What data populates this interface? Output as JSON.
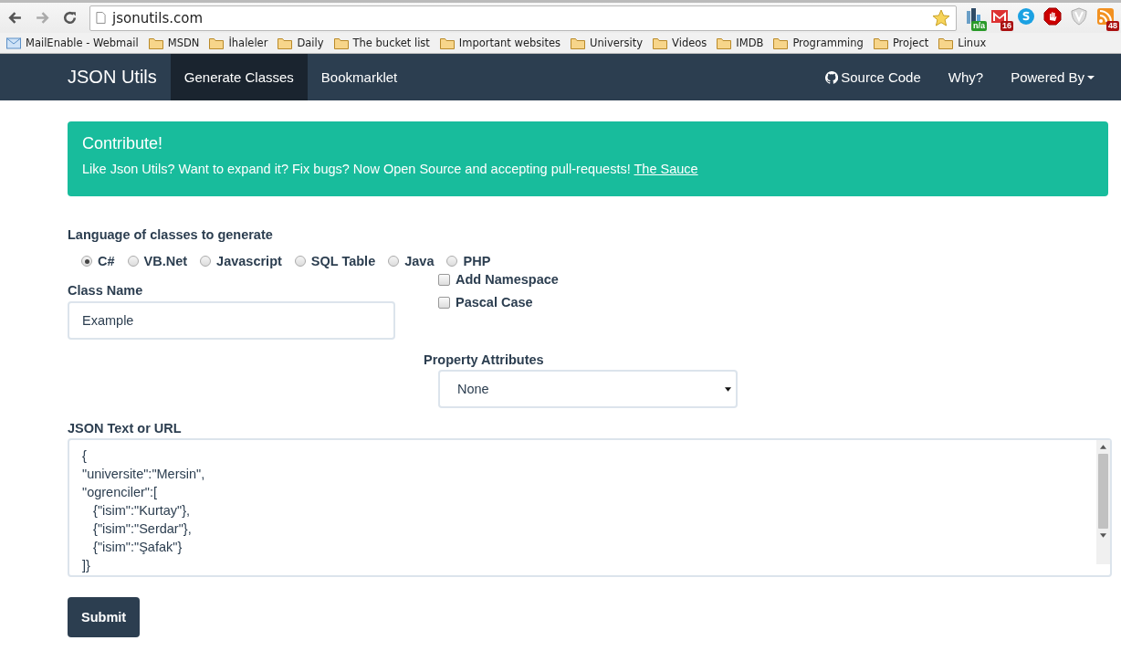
{
  "browser": {
    "url": "jsonutils.com",
    "bookmarks": [
      {
        "label": "MailEnable - Webmail",
        "kind": "mail"
      },
      {
        "label": "MSDN",
        "kind": "folder"
      },
      {
        "label": "İhaleler",
        "kind": "folder"
      },
      {
        "label": "Daily",
        "kind": "folder"
      },
      {
        "label": "The bucket list",
        "kind": "folder"
      },
      {
        "label": "Important websites",
        "kind": "folder"
      },
      {
        "label": "University",
        "kind": "folder"
      },
      {
        "label": "Videos",
        "kind": "folder"
      },
      {
        "label": "IMDB",
        "kind": "folder"
      },
      {
        "label": "Programming",
        "kind": "folder"
      },
      {
        "label": "Project",
        "kind": "folder"
      },
      {
        "label": "Linux",
        "kind": "folder"
      }
    ],
    "extensions": [
      {
        "kind": "chart",
        "badge": "n/a"
      },
      {
        "kind": "mail",
        "badge": "16"
      },
      {
        "kind": "chat"
      },
      {
        "kind": "stop"
      },
      {
        "kind": "shield"
      },
      {
        "kind": "feed",
        "badge": "48"
      }
    ]
  },
  "navbar": {
    "brand": "JSON Utils",
    "tabs": [
      {
        "label": "Generate Classes",
        "selected": true
      },
      {
        "label": "Bookmarklet",
        "selected": false
      }
    ],
    "right_links": [
      {
        "label": "Source Code",
        "kind": "github"
      },
      {
        "label": "Why?",
        "kind": "plain"
      },
      {
        "label": "Powered By",
        "kind": "dropdown"
      }
    ]
  },
  "alert": {
    "title": "Contribute!",
    "text": "Like Json Utils? Want to expand it? Fix bugs? Now Open Source and accepting pull-requests! ",
    "link": "The Sauce"
  },
  "form": {
    "language_label": "Language of classes to generate",
    "languages": [
      {
        "label": "C#",
        "selected": true
      },
      {
        "label": "VB.Net",
        "selected": false
      },
      {
        "label": "Javascript",
        "selected": false
      },
      {
        "label": "SQL Table",
        "selected": false
      },
      {
        "label": "Java",
        "selected": false
      },
      {
        "label": "PHP",
        "selected": false
      }
    ],
    "class_name_label": "Class Name",
    "class_name_value": "Example",
    "options": [
      {
        "label": "Add Namespace",
        "checked": false
      },
      {
        "label": "Pascal Case",
        "checked": false
      }
    ],
    "property_label": "Property Attributes",
    "property_value": "None",
    "json_label": "JSON Text or URL",
    "json_lines": [
      "{",
      "\"universite\":\"Mersin\",",
      "\"ogrenciler\":[",
      "   {\"isim\":\"Kurtay\"},",
      "   {\"isim\":\"Serdar\"},",
      "   {\"isim\":\"Şafak\"}",
      "]}"
    ],
    "submit": "Submit"
  }
}
